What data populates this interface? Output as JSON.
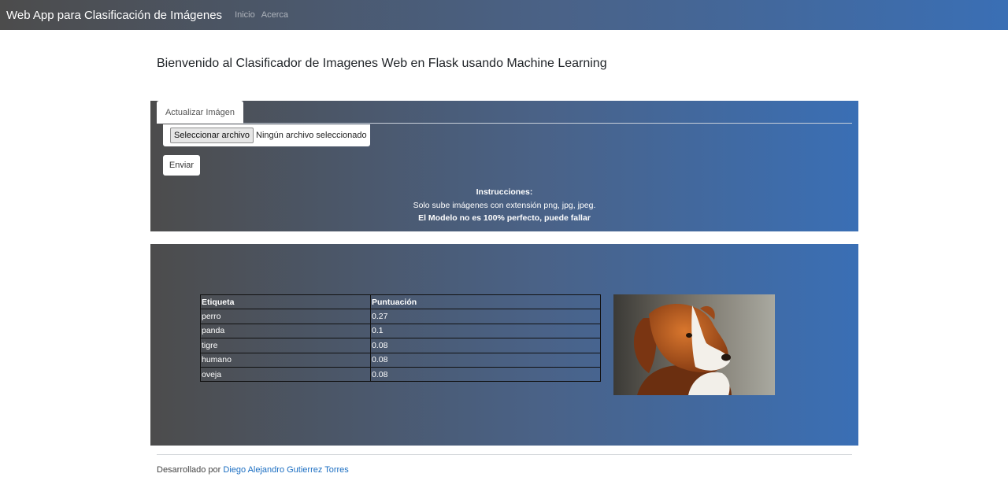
{
  "navbar": {
    "brand": "Web App para Clasificación de Imágenes",
    "links": [
      "Inicio",
      "Acerca"
    ]
  },
  "main": {
    "title": "Bienvenido al Clasificador de Imagenes Web en Flask usando Machine Learning"
  },
  "upload": {
    "tab_label": "Actualizar Imágen",
    "file_button_label": "Seleccionar archivo",
    "file_status": "Ningún archivo seleccionado",
    "submit_label": "Enviar",
    "instructions": {
      "heading": "Instrucciones:",
      "line1": "Solo sube imágenes con extensión png, jpg, jpeg.",
      "line2": "El Modelo no es 100% perfecto, puede fallar"
    }
  },
  "results": {
    "headers": [
      "Etiqueta",
      "Puntuación"
    ],
    "rows": [
      [
        "perro",
        "0.27"
      ],
      [
        "panda",
        "0.1"
      ],
      [
        "tigre",
        "0.08"
      ],
      [
        "humano",
        "0.08"
      ],
      [
        "oveja",
        "0.08"
      ]
    ]
  },
  "footer": {
    "prefix": "Desarrollado por",
    "author": "Diego Alejandro Gutierrez Torres"
  },
  "colors": {
    "gradient_start": "#4c4c4c",
    "gradient_end": "#3a6fb5",
    "link": "#1b6ec2"
  }
}
